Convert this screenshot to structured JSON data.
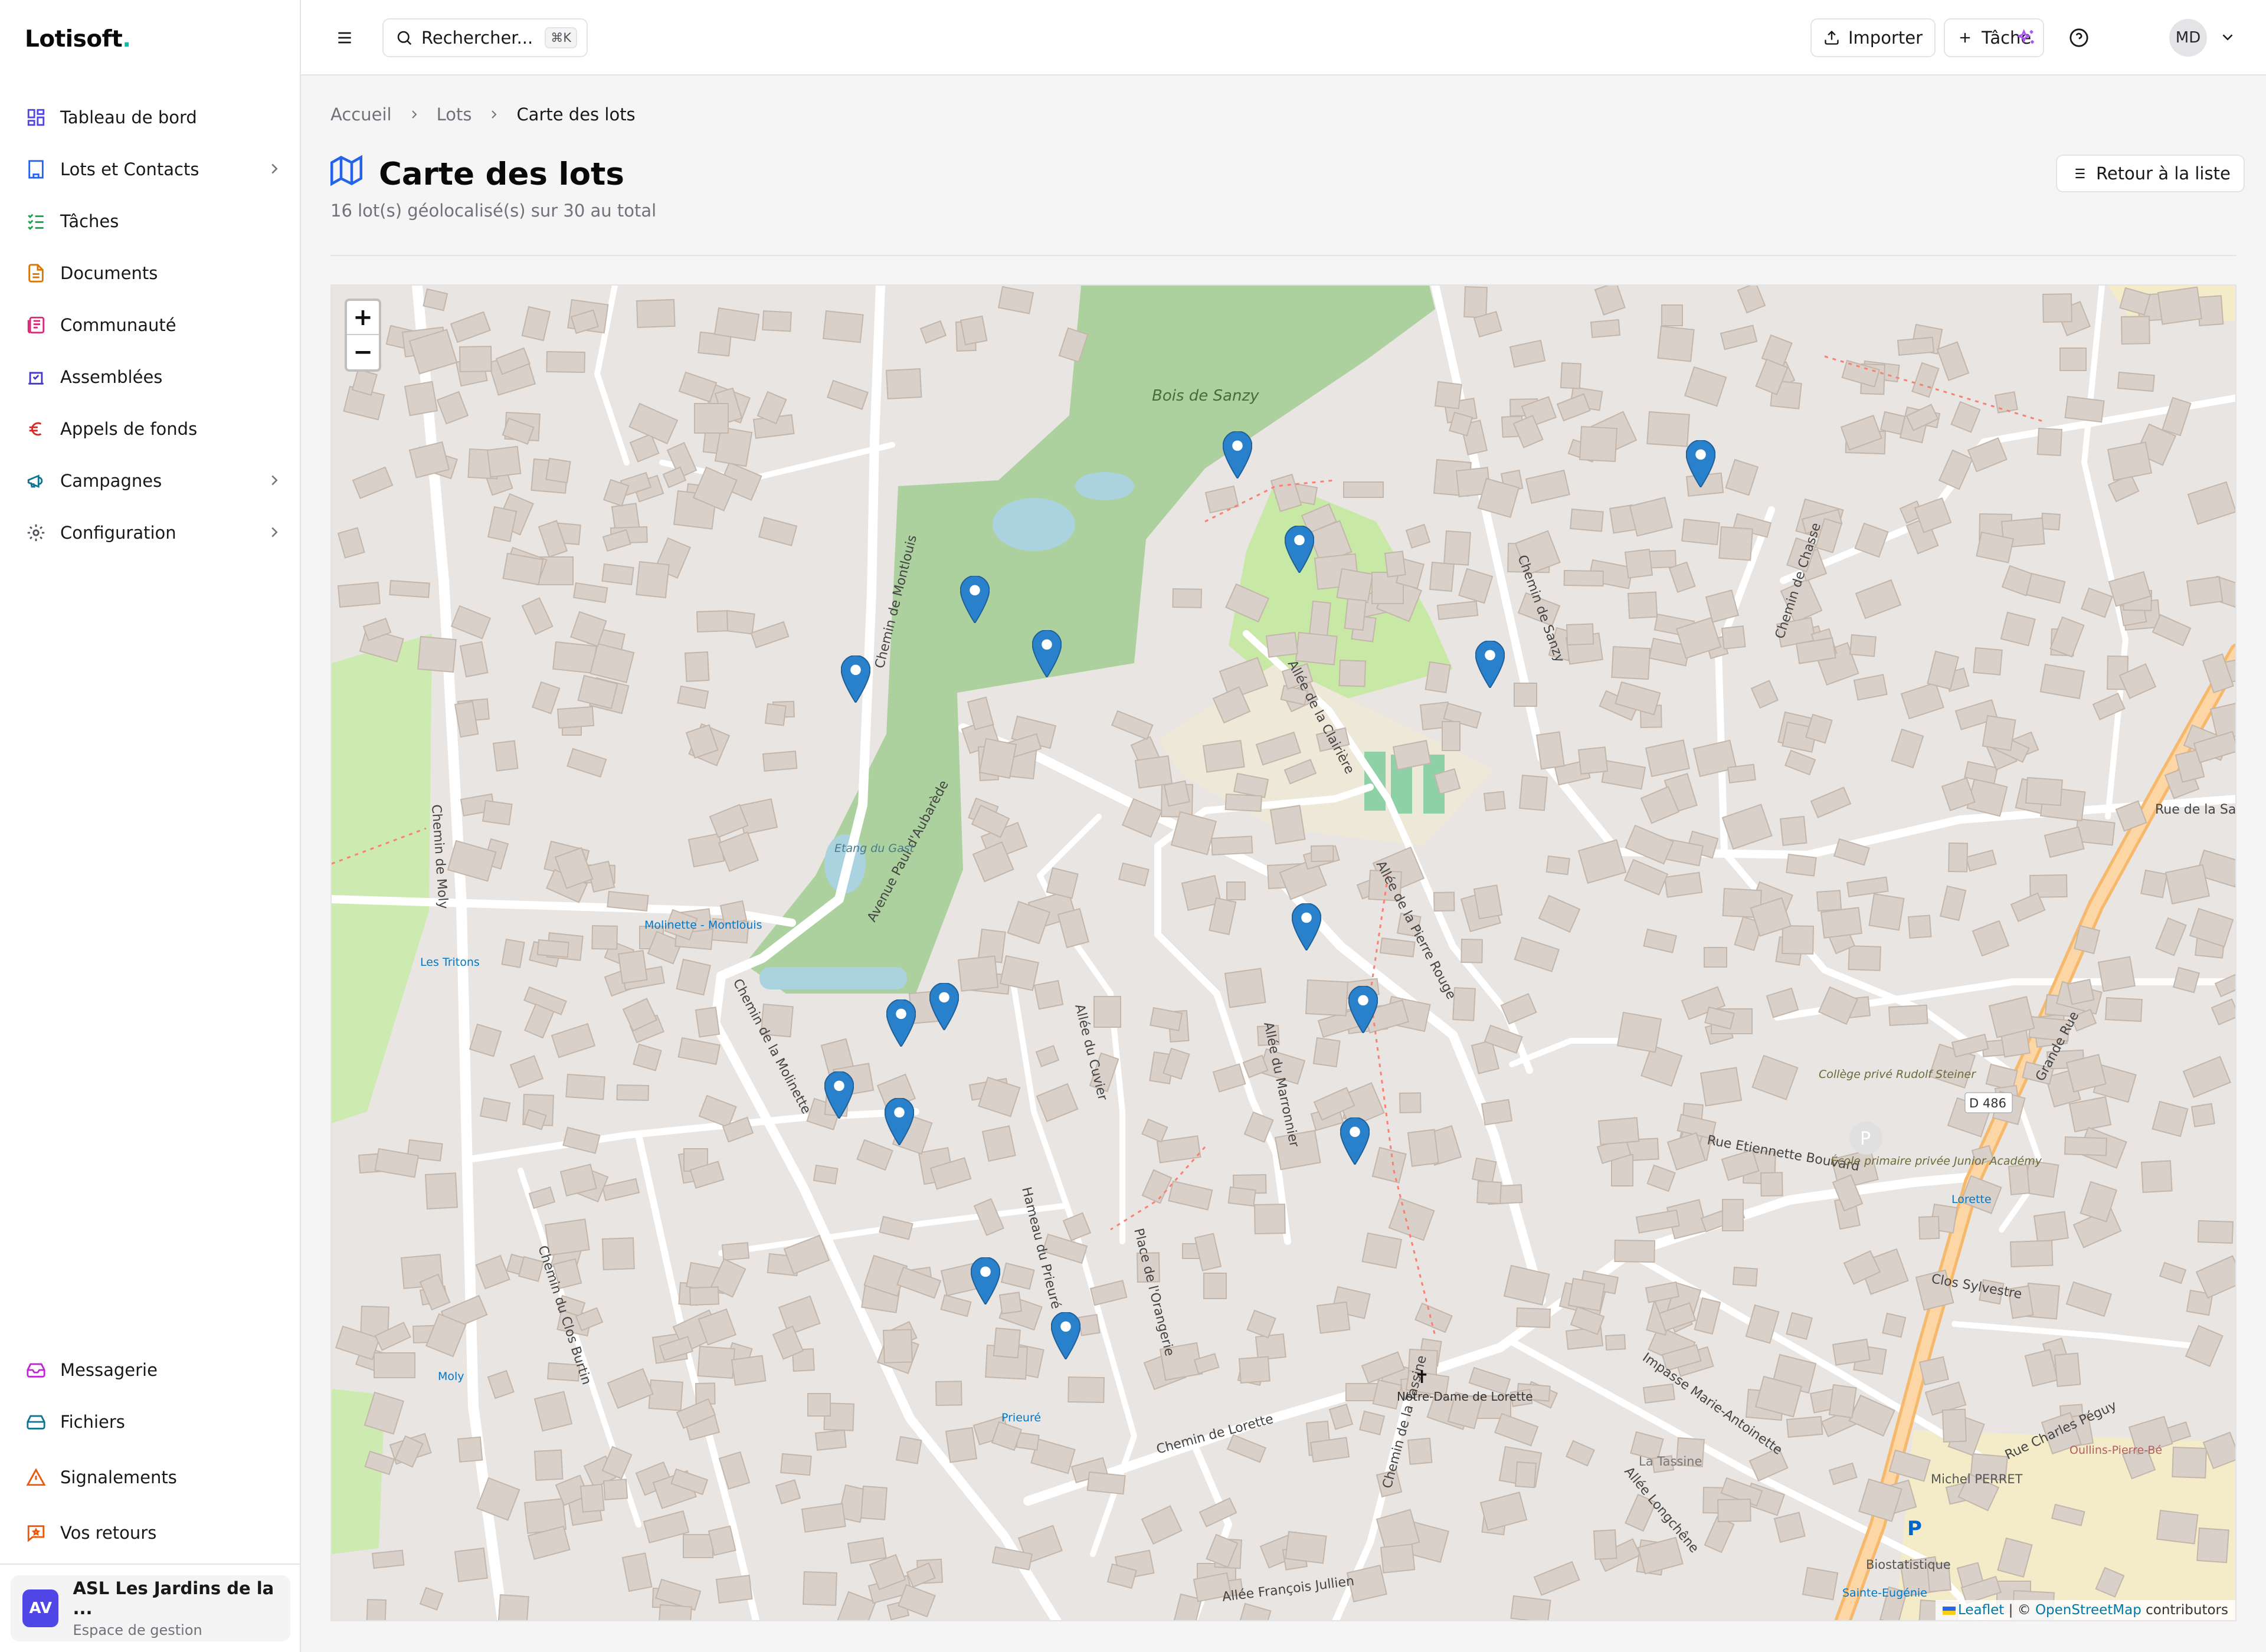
{
  "app": {
    "logo_text": "Lotisoft",
    "logo_dot": "."
  },
  "sidebar": {
    "items": [
      {
        "label": "Tableau de bord",
        "icon": "dashboard-icon",
        "color": "#4f46e5"
      },
      {
        "label": "Lots et Contacts",
        "icon": "building-icon",
        "color": "#2563eb",
        "has_submenu": true
      },
      {
        "label": "Tâches",
        "icon": "checklist-icon",
        "color": "#16a34a"
      },
      {
        "label": "Documents",
        "icon": "document-icon",
        "color": "#d97706"
      },
      {
        "label": "Communauté",
        "icon": "newspaper-icon",
        "color": "#db2777"
      },
      {
        "label": "Assemblées",
        "icon": "vote-icon",
        "color": "#4338ca"
      },
      {
        "label": "Appels de fonds",
        "icon": "euro-icon",
        "color": "#dc2626"
      },
      {
        "label": "Campagnes",
        "icon": "megaphone-icon",
        "color": "#0e7490",
        "has_submenu": true
      },
      {
        "label": "Configuration",
        "icon": "gear-icon",
        "color": "#52525b",
        "has_submenu": true
      }
    ],
    "bottom_items": [
      {
        "label": "Messagerie",
        "icon": "inbox-icon",
        "color": "#c026d3"
      },
      {
        "label": "Fichiers",
        "icon": "hard-drive-icon",
        "color": "#0e7490"
      },
      {
        "label": "Signalements",
        "icon": "warning-icon",
        "color": "#ea580c"
      },
      {
        "label": "Vos retours",
        "icon": "feedback-icon",
        "color": "#ea580c"
      }
    ],
    "org": {
      "initials": "AV",
      "name": "ASL Les Jardins de la ...",
      "subtitle": "Espace de gestion"
    }
  },
  "topbar": {
    "search_placeholder": "Rechercher...",
    "search_shortcut": "⌘K",
    "import_label": "Importer",
    "task_label": "Tâche",
    "user_initials": "MD"
  },
  "breadcrumb": {
    "home": "Accueil",
    "lots": "Lots",
    "current": "Carte des lots"
  },
  "page": {
    "title": "Carte des lots",
    "subtitle": "16 lot(s) géolocalisé(s) sur 30 au total",
    "back_label": "Retour à la liste"
  },
  "map": {
    "zoom_in": "+",
    "zoom_out": "−",
    "attribution_leaflet": "Leaflet",
    "attribution_sep": " | © ",
    "attribution_osm": "OpenStreetMap",
    "attribution_tail": " contributors",
    "marker_count": 16,
    "labels": [
      {
        "text": "Bois de Sanzy"
      },
      {
        "text": "Chemin de Montlouis"
      },
      {
        "text": "Avenue Paul d'Aubarède"
      },
      {
        "text": "Allée de la Clairière"
      },
      {
        "text": "Chemin de Sanzy"
      },
      {
        "text": "Chemin de Chasse"
      },
      {
        "text": "Rue de la Sarra"
      },
      {
        "text": "Grande Rue"
      },
      {
        "text": "Chemin de la Molinette"
      },
      {
        "text": "Chemin de Moly"
      },
      {
        "text": "Chemin de Lorette"
      },
      {
        "text": "Allée du Marronnier"
      },
      {
        "text": "Allée du Cuvier"
      },
      {
        "text": "Allée de la Pierre Rouge"
      },
      {
        "text": "Hameau du Prieuré"
      },
      {
        "text": "Place de l'Orangerie"
      },
      {
        "text": "Rue Etiennette Bouvard"
      },
      {
        "text": "Clos Sylvestre"
      },
      {
        "text": "Impasse Marie-Antoinette"
      },
      {
        "text": "Rue Charles Péguy"
      },
      {
        "text": "Allée Longchêne"
      },
      {
        "text": "Chemin du Clos Burtin"
      },
      {
        "text": "Allée François Jullien"
      },
      {
        "text": "Chemin de la Tassine"
      },
      {
        "text": "Notre-Dame de Lorette"
      },
      {
        "text": "Collège privé Rudolf Steiner"
      },
      {
        "text": "École primaire privée Junior Académy"
      },
      {
        "text": "Etang du Gast"
      },
      {
        "text": "Molinette - Montlouis"
      },
      {
        "text": "Les Tritons"
      },
      {
        "text": "Moly"
      },
      {
        "text": "Prieuré"
      },
      {
        "text": "Lorette"
      },
      {
        "text": "La Tassine"
      },
      {
        "text": "Michel PERRET"
      },
      {
        "text": "Biostatistique"
      },
      {
        "text": "Sainte-Eugénie"
      },
      {
        "text": "Oullins-Pierre-Bé"
      },
      {
        "text": "D 486"
      }
    ]
  }
}
